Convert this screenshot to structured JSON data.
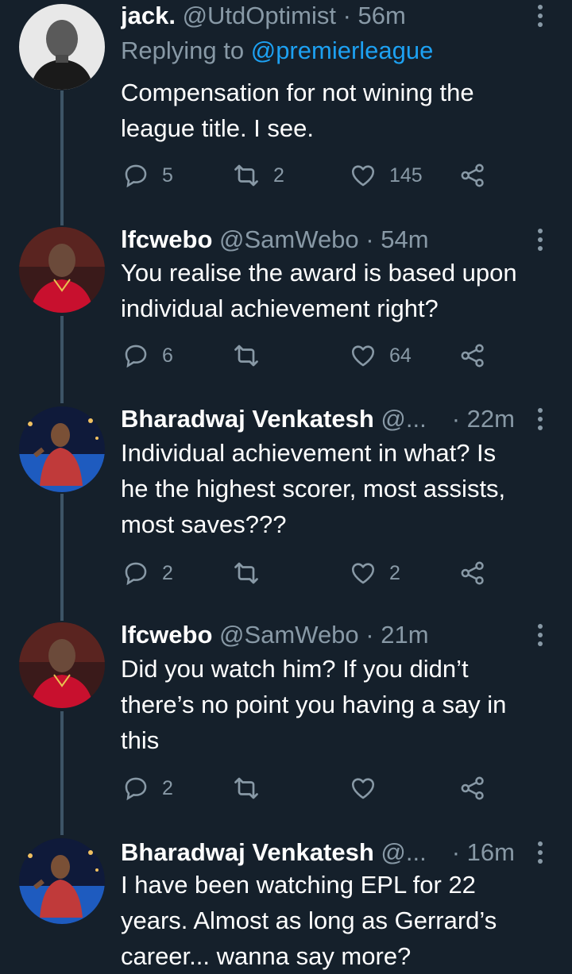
{
  "colors": {
    "background": "#15202b",
    "text": "#ffffff",
    "muted": "#8899a6",
    "link": "#1da1f2",
    "thread": "#3d5466"
  },
  "tweets": [
    {
      "name": "jack.",
      "handle": "@UtdOptimist",
      "time": "· 56m",
      "replying_label": "Replying to",
      "replying_mention": "@premierleague",
      "lines": [
        "Compensation for not wining the",
        "league title. I see."
      ],
      "reply_count": "5",
      "retweet_count": "2",
      "like_count": "145",
      "avatar_icon": "grayscale-portrait"
    },
    {
      "name": "lfcwebo",
      "handle": "@SamWebo",
      "time": "· 54m",
      "lines": [
        "You realise the award is based upon",
        "individual achievement right?"
      ],
      "reply_count": "6",
      "retweet_count": "",
      "like_count": "64",
      "avatar_icon": "red-shirt-portrait"
    },
    {
      "name": "Bharadwaj Venkatesh",
      "handle": "@...",
      "time": "· 22m",
      "lines": [
        "Individual achievement in what? Is",
        "he the highest scorer, most assists,",
        "most saves???"
      ],
      "reply_count": "2",
      "retweet_count": "",
      "like_count": "2",
      "avatar_icon": "poolside-portrait"
    },
    {
      "name": "lfcwebo",
      "handle": "@SamWebo",
      "time": "· 21m",
      "lines": [
        "Did you watch him? If you didn’t",
        "there’s no point you having a say in",
        "this"
      ],
      "reply_count": "2",
      "retweet_count": "",
      "like_count": "",
      "avatar_icon": "red-shirt-portrait"
    },
    {
      "name": "Bharadwaj Venkatesh",
      "handle": "@...",
      "time": "· 16m",
      "lines": [
        "I have been watching EPL for 22",
        "years. Almost as long as Gerrard’s",
        "career... wanna say more?"
      ],
      "avatar_icon": "poolside-portrait"
    }
  ]
}
